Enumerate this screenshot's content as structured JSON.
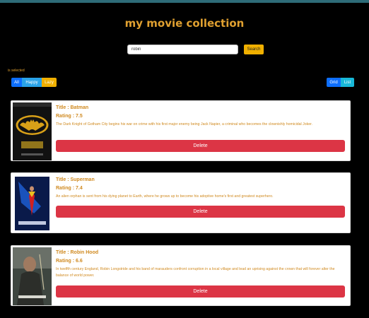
{
  "header": {
    "title": "my movie collection"
  },
  "search": {
    "value": "robin",
    "button_label": "Search"
  },
  "filter": {
    "selected_text": "is selected",
    "buttons": [
      {
        "label": "All",
        "color": "#0d6efd"
      },
      {
        "label": "Happy",
        "color": "#2aa3e8"
      },
      {
        "label": "Lazy",
        "color": "#f0b000"
      }
    ]
  },
  "view": {
    "buttons": [
      {
        "label": "Grid",
        "color": "#0d6efd"
      },
      {
        "label": "List",
        "color": "#18b8d8"
      }
    ]
  },
  "movies": [
    {
      "title": "Title : Batman",
      "rating": "Rating : 7.5",
      "description": "The Dark Knight of Gotham City begins his war on crime with his first major enemy being Jack Napier, a criminal who becomes the clownishly homicidal Joker.",
      "delete_label": "Delete"
    },
    {
      "title": "Title : Superman",
      "rating": "Rating : 7.4",
      "description": "An alien orphan is sent from his dying planet to Earth, where he grows up to become his adoptive home's first and greatest superhero.",
      "delete_label": "Delete"
    },
    {
      "title": "Title : Robin Hood",
      "rating": "Rating : 6.6",
      "description": "In twelfth century England, Robin Longstride and his band of marauders confront corruption in a local village and lead an uprising against the crown that will forever alter the balance of world power.",
      "delete_label": "Delete"
    }
  ],
  "colors": {
    "accent": "#e0a030",
    "delete": "#dc3545",
    "background": "#000000"
  }
}
